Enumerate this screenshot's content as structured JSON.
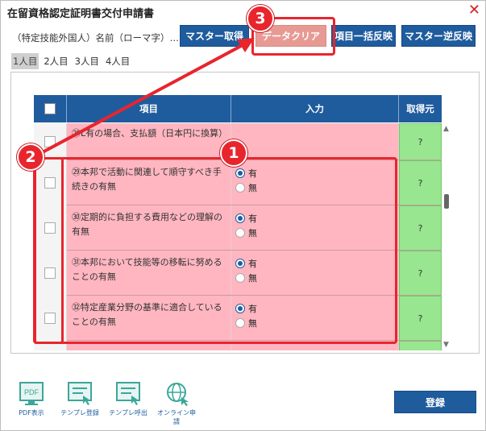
{
  "window": {
    "title": "在留資格認定証明書交付申請書",
    "close_symbol": "✕"
  },
  "toolbar": {
    "name_label": "（特定技能外国人）名前（ローマ字）…",
    "buttons": [
      {
        "label": "マスター取得"
      },
      {
        "label": "データクリア",
        "state": "disabled"
      },
      {
        "label": "項目一括反映"
      },
      {
        "label": "マスター逆反映"
      }
    ]
  },
  "tabs": [
    "1人目",
    "2人目",
    "3人目",
    "4人目"
  ],
  "active_tab": "1人目",
  "table": {
    "headers": {
      "item": "項目",
      "input": "入力",
      "source": "取得元"
    },
    "rows": [
      {
        "item": "㉘L有の場合、支払額（日本円に換算）",
        "source": "?"
      },
      {
        "item": "㉙本邦で活動に関連して順守すべき手続きの有無",
        "options": [
          "有",
          "無"
        ],
        "selected": "有",
        "source": "?"
      },
      {
        "item": "㉚定期的に負担する費用などの理解の有無",
        "options": [
          "有",
          "無"
        ],
        "selected": "有",
        "source": "?"
      },
      {
        "item": "㉛本邦において技能等の移転に努めることの有無",
        "options": [
          "有",
          "無"
        ],
        "selected": "有",
        "source": "?"
      },
      {
        "item": "㉜特定産業分野の基準に適合していることの有無",
        "options": [
          "有",
          "無"
        ],
        "selected": "有",
        "source": "?"
      }
    ]
  },
  "annotations": {
    "callout_1": "1",
    "callout_2": "2",
    "callout_3": "3",
    "color": "#e8252d"
  },
  "bottom_tools": [
    {
      "label": "PDF表示",
      "icon": "pdf-icon",
      "icon_text": "PDF"
    },
    {
      "label": "テンプレ登録",
      "icon": "template-register-icon"
    },
    {
      "label": "テンプレ呼出",
      "icon": "template-load-icon"
    },
    {
      "label": "オンライン申請",
      "icon": "online-globe-icon"
    }
  ],
  "register_button": {
    "label": "登録"
  },
  "colors": {
    "primary": "#1f5c9e",
    "row_pink": "#ffb6c1",
    "source_green": "#98e68f",
    "disabled_button": "#e79a93"
  }
}
